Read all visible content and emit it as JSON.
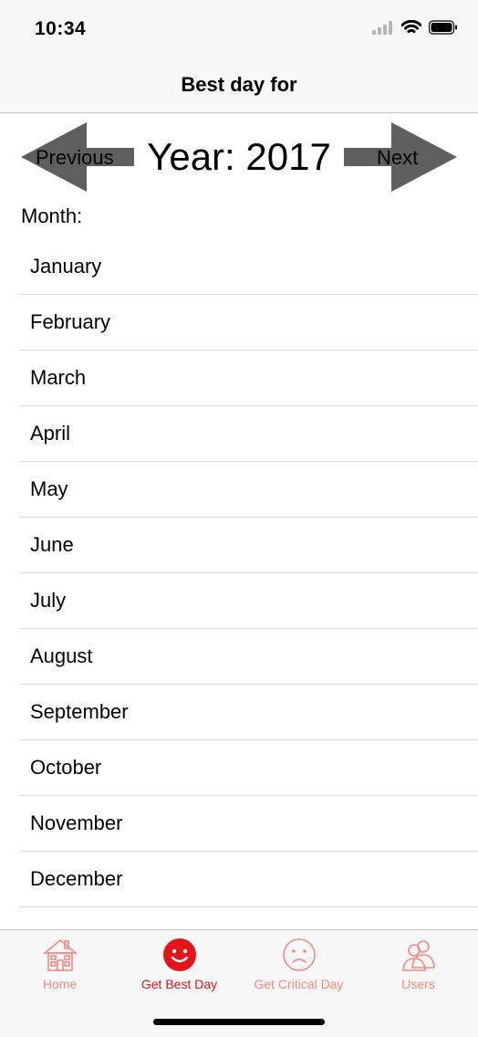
{
  "status_bar": {
    "time": "10:34"
  },
  "nav": {
    "title": "Best day for"
  },
  "year_nav": {
    "previous_label": "Previous",
    "next_label": "Next",
    "year_label": "Year: 2017"
  },
  "month_caption": "Month:",
  "months": [
    "January",
    "February",
    "March",
    "April",
    "May",
    "June",
    "July",
    "August",
    "September",
    "October",
    "November",
    "December"
  ],
  "tab_bar": {
    "items": [
      {
        "label": "Home",
        "icon": "house-icon",
        "selected": false
      },
      {
        "label": "Get Best Day",
        "icon": "smiley-face-icon",
        "selected": true
      },
      {
        "label": "Get Critical Day",
        "icon": "sad-face-icon",
        "selected": false
      },
      {
        "label": "Users",
        "icon": "users-icon",
        "selected": false
      }
    ]
  },
  "colors": {
    "accent": "#e3141b",
    "tab_inactive": "#f08a80",
    "arrow_fill": "#5f5f5f",
    "bar_background": "#f7f7f7"
  }
}
